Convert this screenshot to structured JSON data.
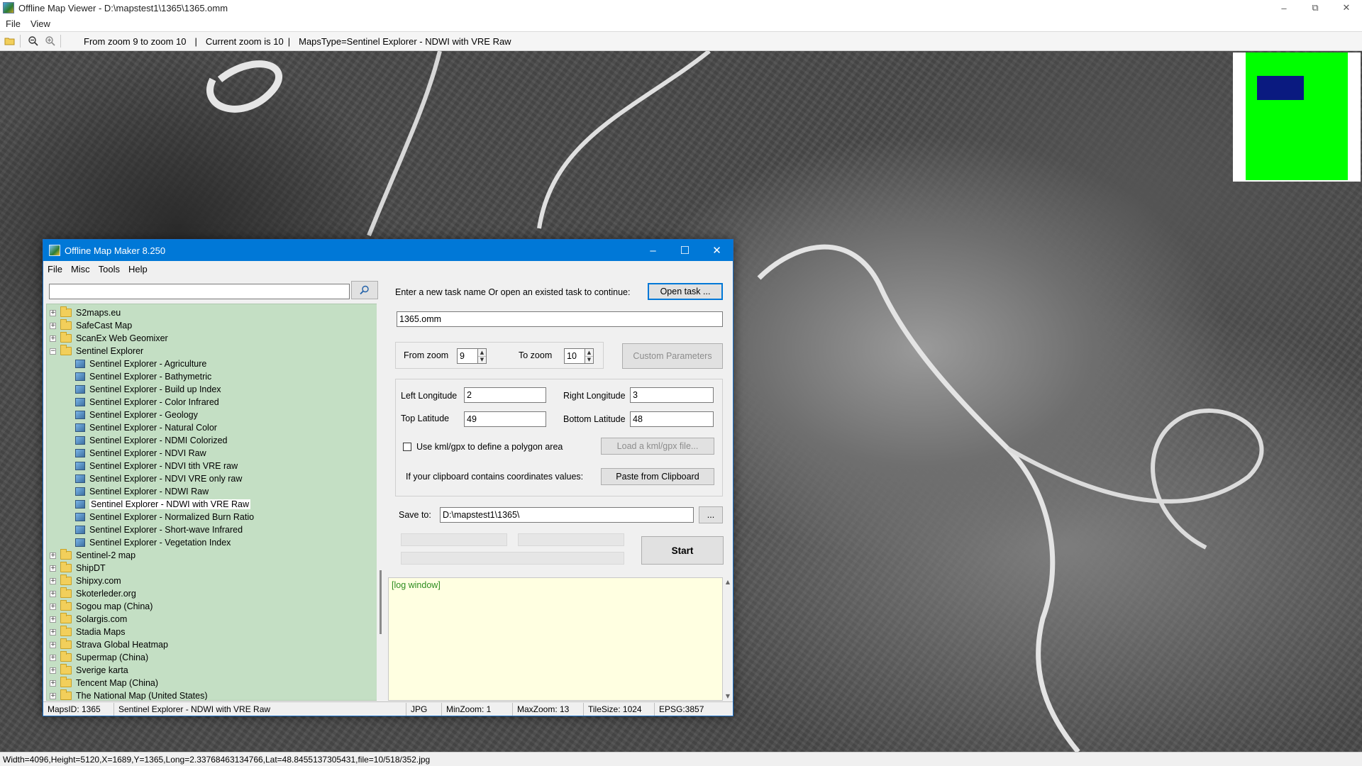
{
  "viewer": {
    "title": "Offline Map Viewer - D:\\mapstest1\\1365\\1365.omm",
    "menu": [
      "File",
      "View"
    ],
    "toolbar": {
      "zoom_range": "From zoom 9 to zoom 10",
      "current_zoom": "Current zoom is 10",
      "maps_type": "MapsType=Sentinel Explorer - NDWI with VRE Raw",
      "separator": "|"
    },
    "status": "Width=4096,Height=5120,X=1689,Y=1365,Long=2.33768463134766,Lat=48.8455137305431,file=10/518/352.jpg",
    "window_controls": [
      "–",
      "⧉",
      "✕"
    ]
  },
  "dialog": {
    "title": "Offline Map Maker 8.250",
    "menu": [
      "File",
      "Misc",
      "Tools",
      "Help"
    ],
    "window_controls": [
      "–",
      "☐",
      "✕"
    ],
    "search": {
      "value": "",
      "placeholder": ""
    },
    "tree": [
      {
        "label": "S2maps.eu",
        "type": "folder",
        "expanded": false,
        "level": 0
      },
      {
        "label": "SafeCast Map",
        "type": "folder",
        "expanded": false,
        "level": 0
      },
      {
        "label": "ScanEx Web Geomixer",
        "type": "folder",
        "expanded": false,
        "level": 0
      },
      {
        "label": "Sentinel Explorer",
        "type": "folder",
        "expanded": true,
        "level": 0
      },
      {
        "label": "Sentinel Explorer - Agriculture",
        "type": "map",
        "level": 1
      },
      {
        "label": "Sentinel Explorer - Bathymetric",
        "type": "map",
        "level": 1
      },
      {
        "label": "Sentinel Explorer - Build up Index",
        "type": "map",
        "level": 1
      },
      {
        "label": "Sentinel Explorer - Color Infrared",
        "type": "map",
        "level": 1
      },
      {
        "label": "Sentinel Explorer - Geology",
        "type": "map",
        "level": 1
      },
      {
        "label": "Sentinel Explorer - Natural Color",
        "type": "map",
        "level": 1
      },
      {
        "label": "Sentinel Explorer - NDMI Colorized",
        "type": "map",
        "level": 1
      },
      {
        "label": "Sentinel Explorer - NDVI Raw",
        "type": "map",
        "level": 1
      },
      {
        "label": "Sentinel Explorer - NDVI tith VRE raw",
        "type": "map",
        "level": 1
      },
      {
        "label": "Sentinel Explorer - NDVI VRE only raw",
        "type": "map",
        "level": 1
      },
      {
        "label": "Sentinel Explorer - NDWI Raw",
        "type": "map",
        "level": 1
      },
      {
        "label": "Sentinel Explorer - NDWI with VRE Raw",
        "type": "map",
        "level": 1,
        "selected": true
      },
      {
        "label": "Sentinel Explorer - Normalized Burn Ratio",
        "type": "map",
        "level": 1
      },
      {
        "label": "Sentinel Explorer - Short-wave Infrared",
        "type": "map",
        "level": 1
      },
      {
        "label": "Sentinel Explorer - Vegetation Index",
        "type": "map",
        "level": 1
      },
      {
        "label": "Sentinel-2 map",
        "type": "folder",
        "expanded": false,
        "level": 0
      },
      {
        "label": "ShipDT",
        "type": "folder",
        "expanded": false,
        "level": 0
      },
      {
        "label": "Shipxy.com",
        "type": "folder",
        "expanded": false,
        "level": 0
      },
      {
        "label": "Skoterleder.org",
        "type": "folder",
        "expanded": false,
        "level": 0
      },
      {
        "label": "Sogou map (China)",
        "type": "folder",
        "expanded": false,
        "level": 0
      },
      {
        "label": "Solargis.com",
        "type": "folder",
        "expanded": false,
        "level": 0
      },
      {
        "label": "Stadia Maps",
        "type": "folder",
        "expanded": false,
        "level": 0
      },
      {
        "label": "Strava Global Heatmap",
        "type": "folder",
        "expanded": false,
        "level": 0
      },
      {
        "label": "Supermap (China)",
        "type": "folder",
        "expanded": false,
        "level": 0
      },
      {
        "label": "Sverige karta",
        "type": "folder",
        "expanded": false,
        "level": 0
      },
      {
        "label": "Tencent Map (China)",
        "type": "folder",
        "expanded": false,
        "level": 0
      },
      {
        "label": "The National Map (United States)",
        "type": "folder",
        "expanded": false,
        "level": 0
      }
    ],
    "task_prompt": "Enter a new task name Or open an existed task to continue:",
    "open_task_label": "Open task ...",
    "task_name": "1365.omm",
    "from_zoom_label": "From zoom",
    "from_zoom": "9",
    "to_zoom_label": "To zoom",
    "to_zoom": "10",
    "custom_params_label": "Custom Parameters",
    "left_lon_label": "Left Longitude",
    "left_lon": "2",
    "right_lon_label": "Right Longitude",
    "right_lon": "3",
    "top_lat_label": "Top Latitude",
    "top_lat": "49",
    "bottom_lat_label": "Bottom Latitude",
    "bottom_lat": "48",
    "kml_checkbox_label": "Use kml/gpx to define a polygon area",
    "kml_checked": false,
    "load_kml_label": "Load a kml/gpx file...",
    "clipboard_prompt": "If your clipboard contains coordinates values:",
    "paste_label": "Paste from Clipboard",
    "save_to_label": "Save to:",
    "save_to": "D:\\mapstest1\\1365\\",
    "browse_label": "...",
    "start_label": "Start",
    "log_text": "[log window]",
    "status": {
      "maps_id": "MapsID: 1365",
      "map_name": "Sentinel Explorer - NDWI with VRE Raw",
      "format": "JPG",
      "min_zoom": "MinZoom: 1",
      "max_zoom": "MaxZoom: 13",
      "tile_size": "TileSize: 1024",
      "epsg": "EPSG:3857"
    }
  },
  "colors": {
    "dialog_title": "#0078d7",
    "tree_bg": "#c4dfc4",
    "log_bg": "#ffffe1",
    "log_text": "#2d8c1e",
    "minimap_green": "#00ff00",
    "minimap_view": "#0a1a80"
  }
}
